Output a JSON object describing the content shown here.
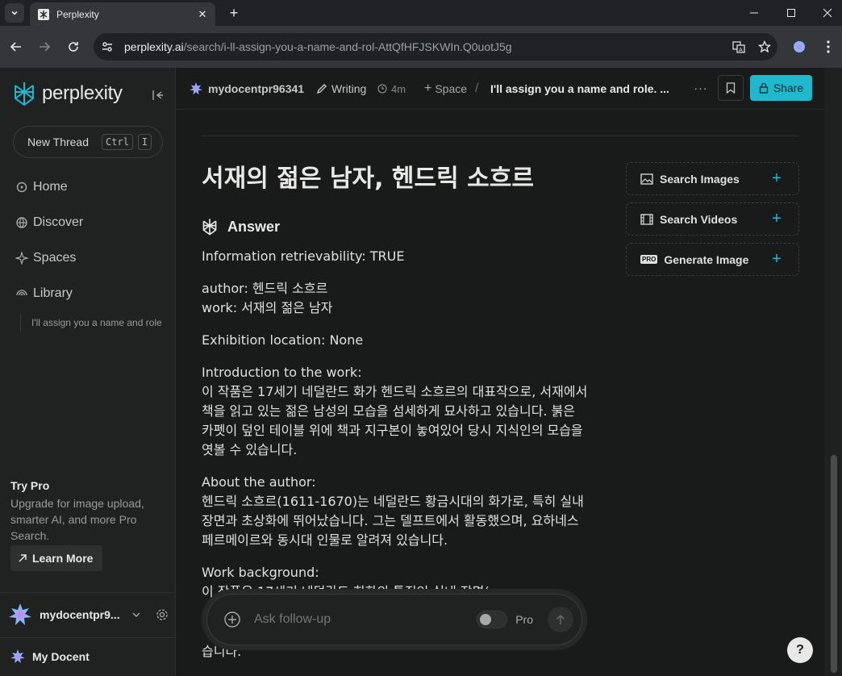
{
  "browser": {
    "tab_title": "Perplexity",
    "url_host": "perplexity.ai",
    "url_path": "/search/i-ll-assign-you-a-name-and-rol-AttQfHFJSKWIn.Q0uotJ5g"
  },
  "sidebar": {
    "brand": "perplexity",
    "new_thread": "New Thread",
    "kbd_ctrl": "Ctrl",
    "kbd_key": "I",
    "nav": [
      {
        "label": "Home",
        "icon": "home-icon"
      },
      {
        "label": "Discover",
        "icon": "discover-icon"
      },
      {
        "label": "Spaces",
        "icon": "spaces-icon"
      },
      {
        "label": "Library",
        "icon": "library-icon"
      }
    ],
    "library_thread": "I'll assign you a name and role...",
    "try_pro_title": "Try Pro",
    "try_pro_text": "Upgrade for image upload, smarter AI, and more Pro Search.",
    "learn_more": "Learn More",
    "username": "mydocentpr9...",
    "space_name": "My Docent"
  },
  "header": {
    "user": "mydocentpr96341",
    "mode": "Writing",
    "time": "4m",
    "space": "Space",
    "thread_title": "I'll assign you a name and role. ...",
    "share": "Share"
  },
  "main": {
    "heading": "서재의 젊은 남자, 헨드릭 소흐르",
    "answer_label": "Answer",
    "paragraphs": [
      "Information retrievability: TRUE",
      "author: 헨드릭 소흐르\nwork: 서재의 젊은 남자",
      "Exhibition location: None",
      "Introduction to the work:\n이 작품은 17세기 네덜란드 화가 헨드릭 소흐르의 대표작으로, 서재에서 책을 읽고 있는 젊은 남성의 모습을 섬세하게 묘사하고 있습니다. 붉은 카펫이 덮인 테이블 위에 책과 지구본이 놓여있어 당시 지식인의 모습을 엿볼 수 있습니다.",
      "About the author:\n헨드릭 소흐르(1611-1670)는 네덜란드 황금시대의 화가로, 특히 실내 장면과 초상화에 뛰어났습니다. 그는 델프트에서 활동했으며, 요하네스 페르메이르와 동시대 인물로 알려져 있습니다.",
      "Work background:\n이 작품은 17세기 네덜란드 회화의 특징인 실내 장면(genre"
    ],
    "trailing_text": "습니다."
  },
  "right_panel": [
    {
      "label": "Search Images",
      "icon": "image-icon"
    },
    {
      "label": "Search Videos",
      "icon": "video-icon"
    },
    {
      "label": "Generate Image",
      "icon": "pro-badge-icon"
    }
  ],
  "followup": {
    "placeholder": "Ask follow-up",
    "pro_label": "Pro"
  },
  "help": "?"
}
